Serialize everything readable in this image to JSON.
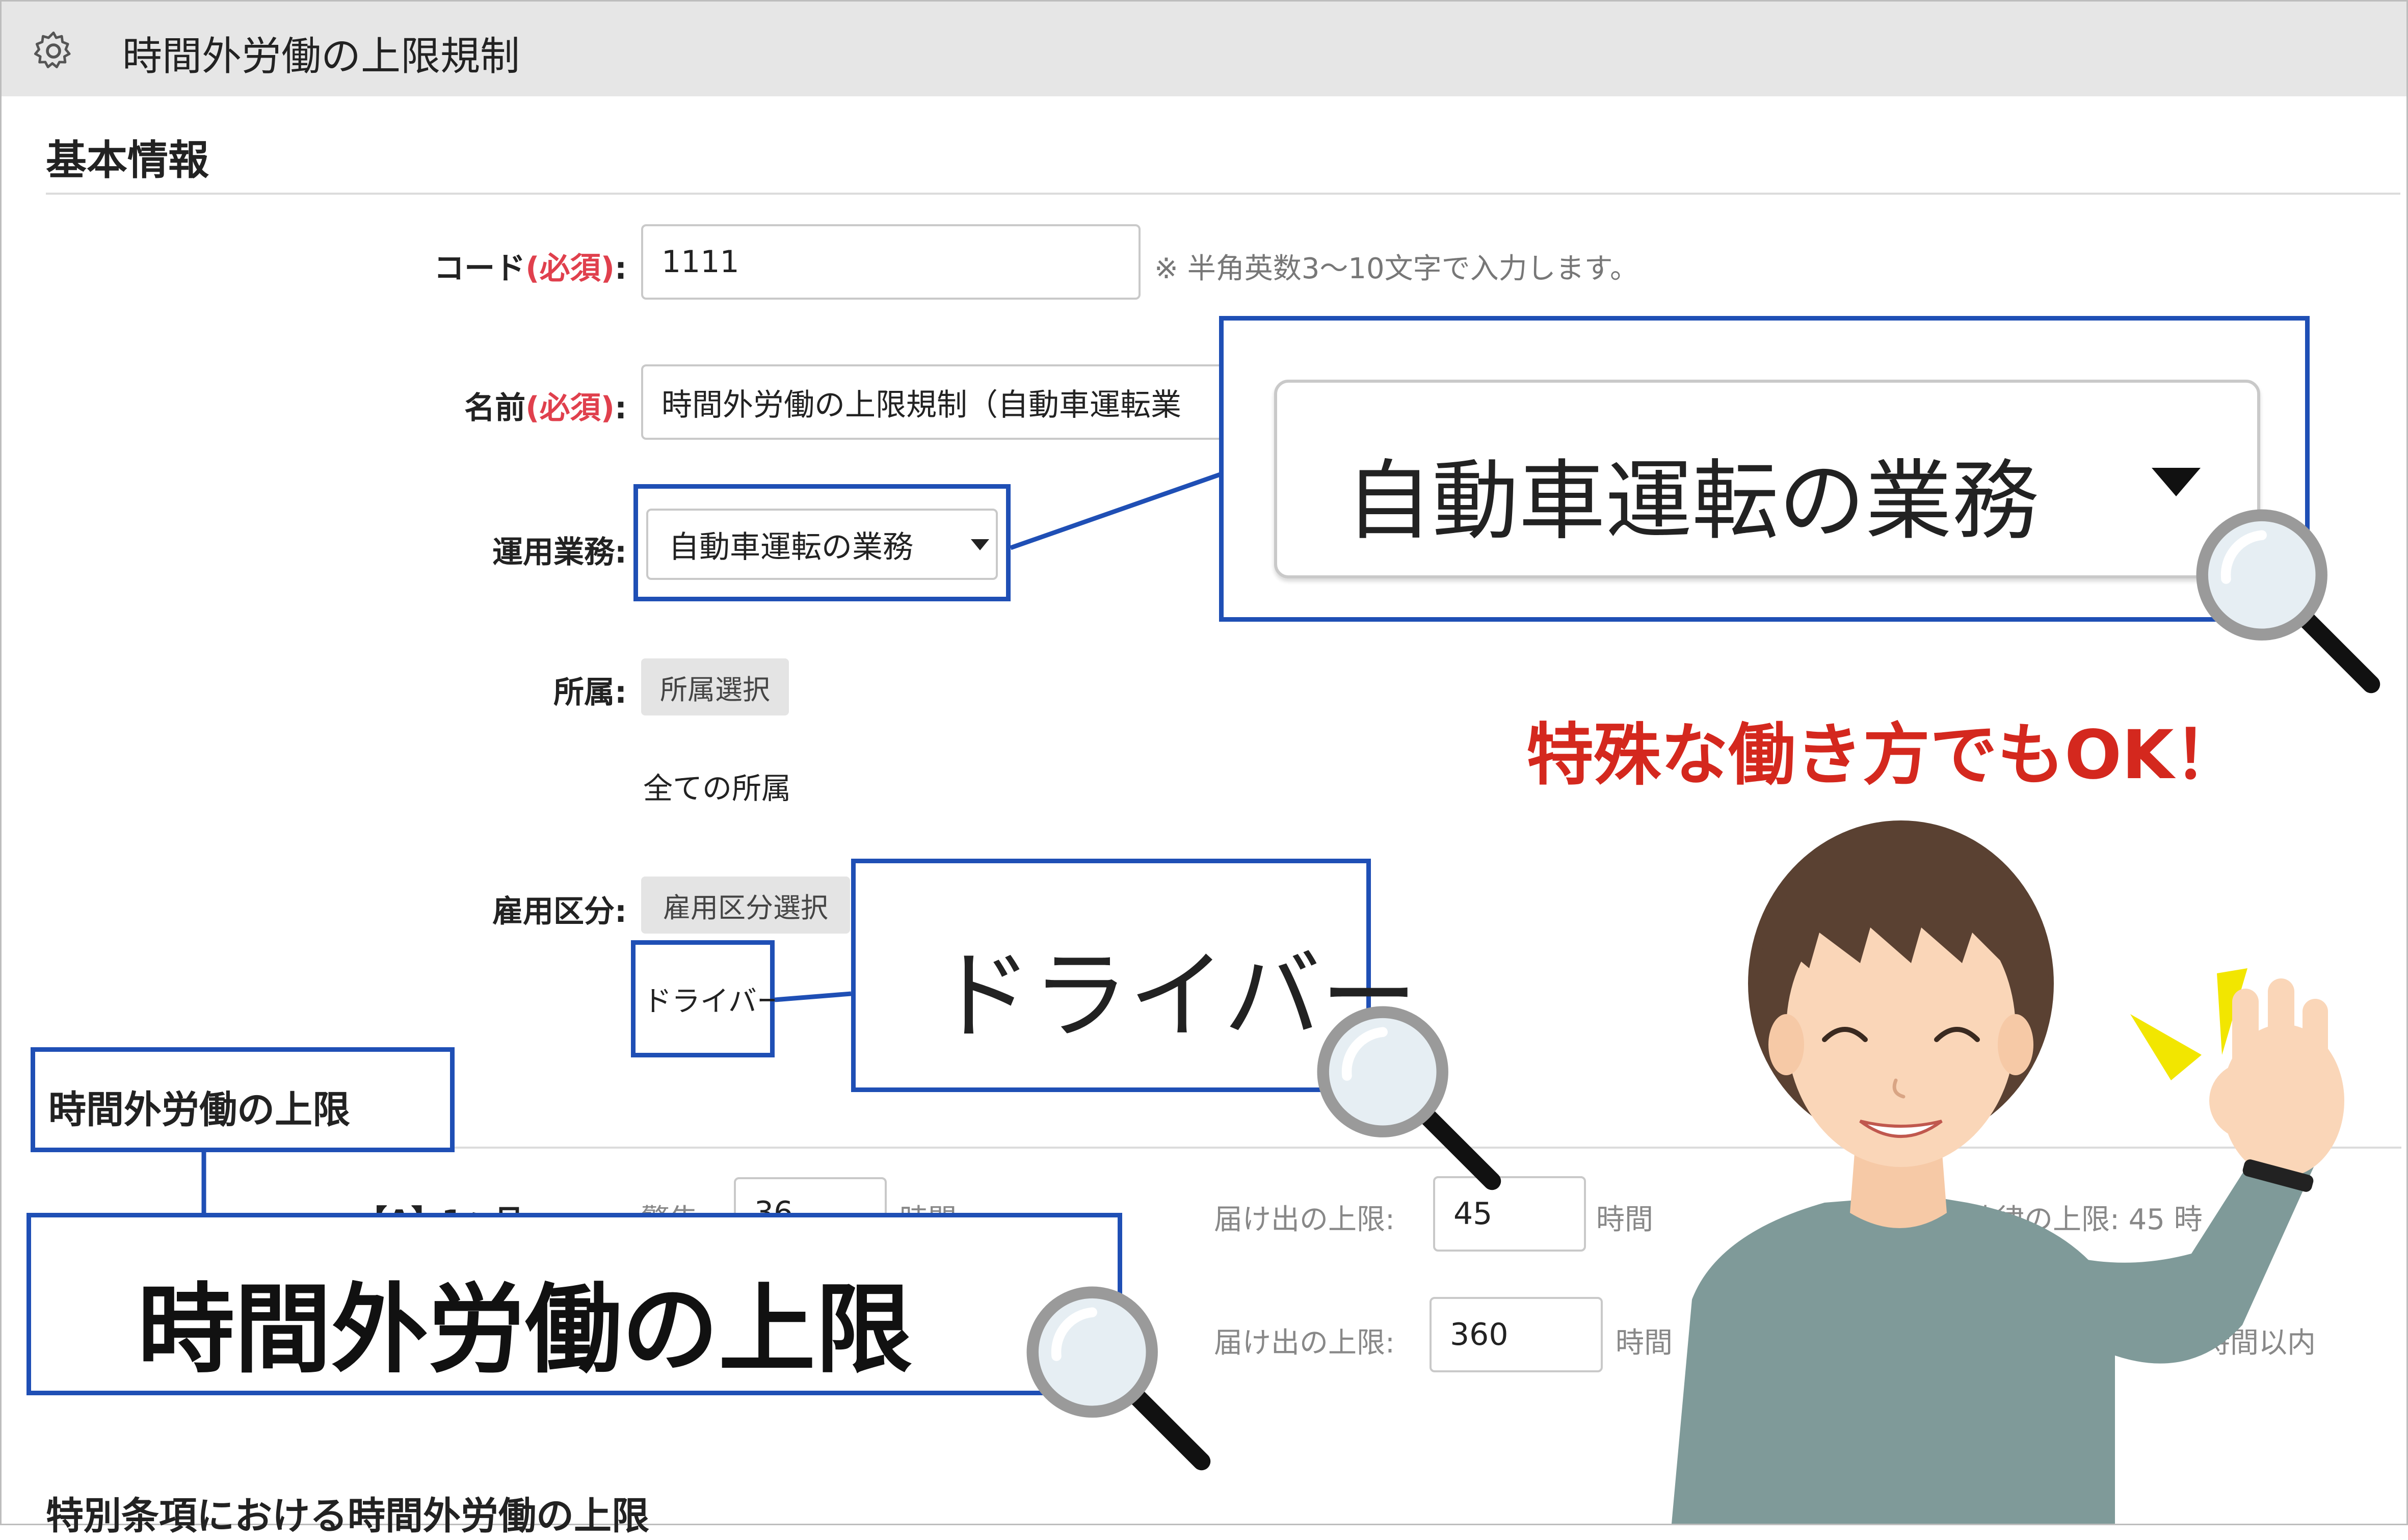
{
  "header": {
    "title": "時間外労働の上限規制"
  },
  "basic_info": {
    "heading": "基本情報",
    "code": {
      "label": "コード",
      "required": "(必須)",
      "colon": ":",
      "value": "1111",
      "hint": "※ 半角英数3〜10文字で入力します。"
    },
    "name": {
      "label": "名前",
      "required": "(必須)",
      "colon": ":",
      "value": "時間外労働の上限規制（自動車運転業"
    },
    "operation": {
      "label": "運用業務:",
      "value": "自動車運転の業務"
    },
    "affiliation": {
      "label": "所属:",
      "button": "所属選択",
      "value": "全ての所属"
    },
    "employment": {
      "label": "雇用区分:",
      "button": "雇用区分選択",
      "value": "ドライバー"
    }
  },
  "overtime": {
    "heading": "時間外労働の上限",
    "row1": {
      "label_partial": "【A】1ヶ月",
      "warn_label": "警告:",
      "warn_value": "36",
      "warn_unit": "時間",
      "limit_label": "届け出の上限:",
      "limit_value": "45",
      "limit_unit": "時間",
      "law_text": "法律の上限: 45 時"
    },
    "row2": {
      "limit_label": "届け出の上限:",
      "limit_value": "360",
      "limit_unit": "時間",
      "law_text": "時間以内"
    }
  },
  "special": {
    "heading": "特別条項における時間外労働の上限"
  },
  "callouts": {
    "operation_zoom": "自動車運転の業務",
    "driver_zoom": "ドライバー",
    "overtime_zoom": "時間外労働の上限"
  },
  "promo": {
    "text": "特殊な働き方でもOK！"
  },
  "colors": {
    "accent_blue": "#1f4fb5",
    "promo_red": "#d4281e",
    "required_red": "#e0404d"
  }
}
